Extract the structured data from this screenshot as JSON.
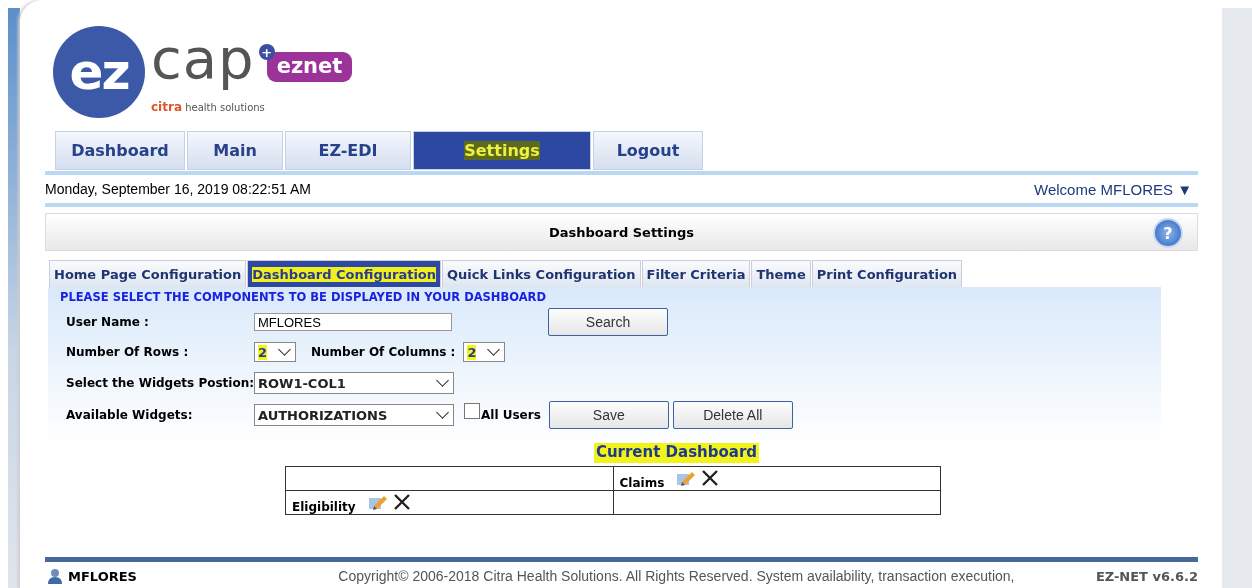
{
  "logo": {
    "mark": "ez",
    "word": "cap",
    "badge_plus": "+",
    "badge": "eznet",
    "brand": "citra",
    "tagline": "health solutions"
  },
  "nav": [
    {
      "label": "Dashboard",
      "selected": false,
      "highlighted": false
    },
    {
      "label": "Main",
      "selected": false,
      "highlighted": false
    },
    {
      "label": "EZ-EDI",
      "selected": false,
      "highlighted": false
    },
    {
      "label": "Settings",
      "selected": true,
      "highlighted": true
    },
    {
      "label": "Logout",
      "selected": false,
      "highlighted": false
    }
  ],
  "datetime": "Monday, September 16, 2019 08:22:51 AM",
  "welcome": "Welcome MFLORES",
  "welcome_caret": "▼",
  "panel_title": "Dashboard Settings",
  "help": "?",
  "tabs": [
    {
      "label": "Home Page Configuration",
      "selected": false,
      "highlighted": false
    },
    {
      "label": "Dashboard Configuration",
      "selected": true,
      "highlighted": true
    },
    {
      "label": "Quick Links Configuration",
      "selected": false,
      "highlighted": false
    },
    {
      "label": "Filter Criteria",
      "selected": false,
      "highlighted": false
    },
    {
      "label": "Theme",
      "selected": false,
      "highlighted": false
    },
    {
      "label": "Print Configuration",
      "selected": false,
      "highlighted": false
    }
  ],
  "instruction": "PLEASE SELECT THE COMPONENTS TO BE DISPLAYED IN YOUR DASHBOARD",
  "form": {
    "user_name_label": "User Name :",
    "user_name": "MFLORES",
    "search": "Search",
    "rows_label": "Number Of Rows :",
    "rows": "2",
    "rows_highlighted": true,
    "columns_label": "Number Of Columns :",
    "columns": "2",
    "columns_highlighted": true,
    "position_label": "Select the Widgets Postion:",
    "position": "ROW1-COL1",
    "widgets_label": "Available Widgets:",
    "widget": "AUTHORIZATIONS",
    "all_users_label": "All Users",
    "all_users_checked": false,
    "save": "Save",
    "delete_all": "Delete All"
  },
  "current_title": "Current Dashboard",
  "current_title_highlighted": true,
  "grid": [
    {
      "col_2": "Claims"
    },
    {
      "col_1": "Eligibility"
    }
  ],
  "footer": {
    "user": "MFLORES",
    "copyright": "Copyright© 2006-2018 Citra Health Solutions. All Rights Reserved. System availability, transaction execution,",
    "version": "EZ-NET v6.6.2"
  }
}
